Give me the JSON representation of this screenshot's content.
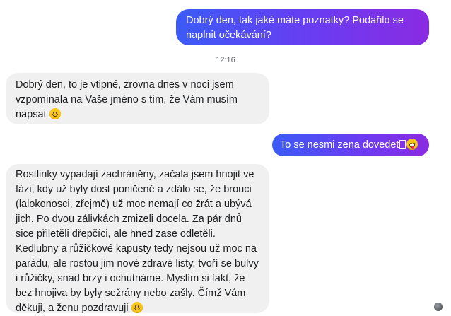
{
  "messages": [
    {
      "from": "me",
      "text": "Dobrý den, tak jaké máte poznatky? Podařilo se naplnit očekávání?"
    },
    {
      "timestamp": "12:16"
    },
    {
      "from": "contact",
      "text": "Dobrý den, to je vtipné, zrovna dnes v noci jsem vzpomínala na Vaše jméno s tím, že Vám musím napsat",
      "emoji": "slightly-smiling-face"
    },
    {
      "from": "me",
      "text": "To se nesmi zena dovedet",
      "emoji": "squinting-face-with-tongue"
    },
    {
      "from": "contact",
      "text": "Rostlinky vypadají zachráněny, začala jsem hnojit ve fázi, kdy už byly dost poničené a zdálo se, že brouci (lalokonosci, zřejmě) už moc nemají co žrát a ubývá jich. Po dvou zálivkách zmizeli docela. Za pár dnů sice přiletěli dřepčíci, ale hned zase odletěli. Kedlubny a růžičkové kapusty tedy nejsou už moc na parádu, ale rostou jim nové zdravé listy, tvoří se bulvy i růžičky, snad brzy i ochutnáme. Myslím si fakt, že bez hnojiva by byly sežrány nebo zašly. Čímž Vám děkuji, a ženu pozdravuji",
      "emoji": "slightly-smiling-face"
    }
  ],
  "colors": {
    "outgoing_start": "#3b5bf6",
    "outgoing_end": "#8a2be2",
    "incoming_bg": "#f0f0f0"
  },
  "icons": {
    "seen_indicator": "avatar"
  }
}
